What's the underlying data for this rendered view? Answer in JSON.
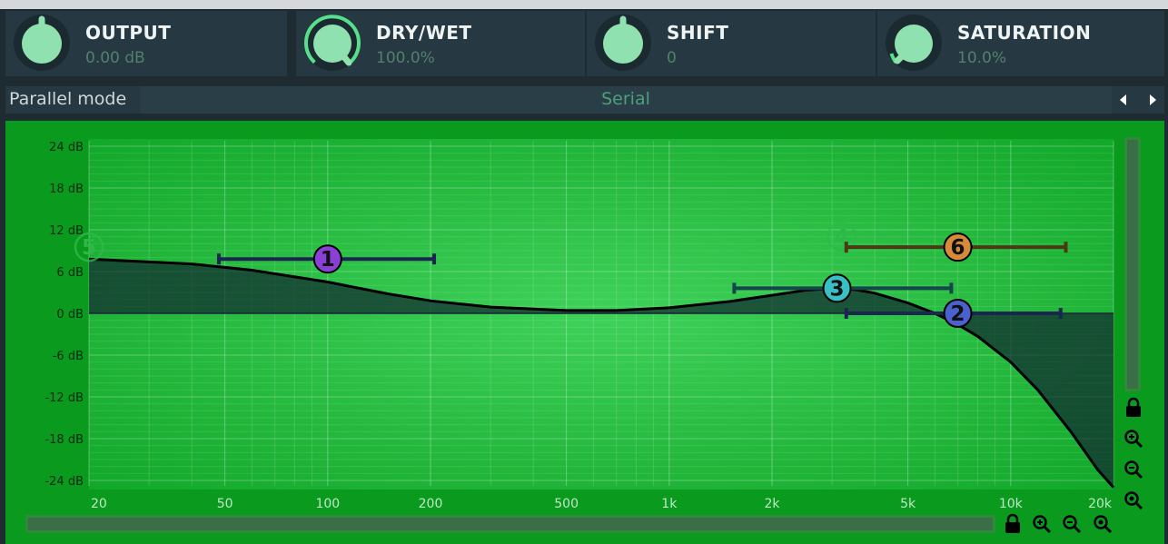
{
  "knobs": [
    {
      "title": "OUTPUT",
      "value": "0.00 dB",
      "level": 0.5
    },
    {
      "title": "DRY/WET",
      "value": "100.0%",
      "level": 1.0
    },
    {
      "title": "SHIFT",
      "value": "0",
      "level": 0.5
    },
    {
      "title": "SATURATION",
      "value": "10.0%",
      "level": 0.1
    }
  ],
  "parallel_mode": {
    "label": "Parallel mode",
    "value": "Serial"
  },
  "chart_data": {
    "type": "line",
    "y_ticks": [
      "24 dB",
      "18 dB",
      "12 dB",
      "6 dB",
      "0 dB",
      "-6 dB",
      "-12 dB",
      "-18 dB",
      "-24 dB"
    ],
    "x_ticks": [
      "20",
      "50",
      "100",
      "200",
      "500",
      "1k",
      "2k",
      "5k",
      "10k",
      "20k"
    ],
    "ylim": [
      -24,
      24
    ],
    "xlim": [
      20,
      20000
    ],
    "x_scale": "log",
    "series": [
      {
        "values_hz_db": [
          [
            20,
            7.8
          ],
          [
            40,
            7.1
          ],
          [
            60,
            6.2
          ],
          [
            100,
            4.5
          ],
          [
            150,
            2.8
          ],
          [
            200,
            1.8
          ],
          [
            300,
            0.9
          ],
          [
            500,
            0.4
          ],
          [
            700,
            0.4
          ],
          [
            1000,
            0.8
          ],
          [
            1500,
            1.7
          ],
          [
            2000,
            2.6
          ],
          [
            2500,
            3.3
          ],
          [
            3000,
            3.6
          ],
          [
            3500,
            3.4
          ],
          [
            4000,
            2.9
          ],
          [
            5000,
            1.5
          ],
          [
            6000,
            0.0
          ],
          [
            7000,
            -1.6
          ],
          [
            8000,
            -3.3
          ],
          [
            10000,
            -7.0
          ],
          [
            12000,
            -11.0
          ],
          [
            15000,
            -17.0
          ],
          [
            18000,
            -22.5
          ],
          [
            20000,
            -25.0
          ]
        ]
      }
    ],
    "bands": [
      {
        "label": "1",
        "freq": 100,
        "gain": 7.8,
        "from": 48,
        "to": 205,
        "color": "#8a3fd6",
        "text_color": "#111111",
        "active": true
      },
      {
        "label": "2",
        "freq": 7000,
        "gain": 0.0,
        "from": 3300,
        "to": 14000,
        "color": "#4a62d0",
        "text_color": "#111111",
        "active": true
      },
      {
        "label": "3",
        "freq": 3100,
        "gain": 3.6,
        "from": 1550,
        "to": 6700,
        "color": "#38c0c4",
        "text_color": "#111111",
        "active": true
      },
      {
        "label": "4",
        "freq": 3200,
        "gain": 11.0,
        "from": 0,
        "to": 0,
        "color": "#0a9a1e",
        "text_color": "#2fb84a",
        "active": false
      },
      {
        "label": "5",
        "freq": 20,
        "gain": 9.5,
        "from": 0,
        "to": 0,
        "color": "#0a9a1e",
        "text_color": "#2fb84a",
        "active": false
      },
      {
        "label": "6",
        "freq": 7000,
        "gain": 9.5,
        "from": 3300,
        "to": 14500,
        "color": "#d68a3a",
        "text_color": "#111111",
        "active": true
      }
    ]
  },
  "icons": {
    "side": [
      "lock-icon",
      "zoom-in-icon",
      "zoom-out-icon",
      "zoom-reset-icon"
    ],
    "bottom": [
      "lock-icon",
      "zoom-in-icon",
      "zoom-out-icon",
      "zoom-reset-icon"
    ]
  }
}
